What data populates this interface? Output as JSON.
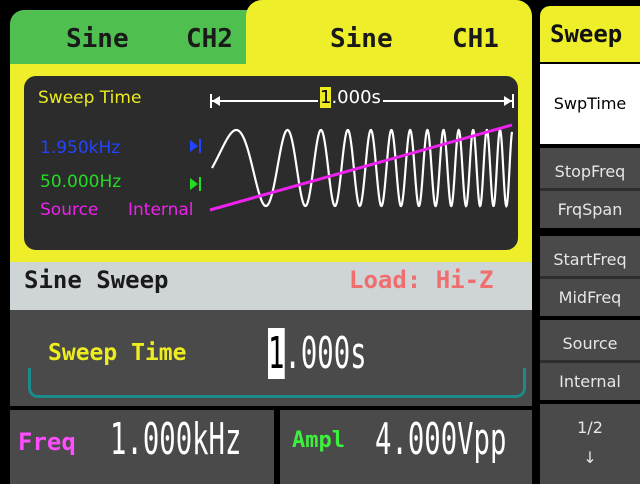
{
  "tabs": [
    {
      "wave": "Sine",
      "channel": "CH2"
    },
    {
      "wave": "Sine",
      "channel": "CH1"
    }
  ],
  "graph": {
    "sweep_time_label": "Sweep Time",
    "sweep_time_value": "1.000s",
    "stop_freq": "1.950kHz",
    "start_freq": "50.000Hz",
    "source_label": "Source",
    "source_value": "Internal"
  },
  "mode": {
    "title": "Sine Sweep",
    "load": "Load: Hi-Z"
  },
  "param": {
    "label": "Sweep Time",
    "value_cursor": "1",
    "value_rest": ".000s"
  },
  "freq": {
    "label": "Freq",
    "value": "1.000kHz"
  },
  "ampl": {
    "label": "Ampl",
    "value": "4.000Vpp"
  },
  "menu": {
    "title": "Sweep",
    "items": [
      {
        "top": "SwpTime",
        "bottom": ""
      },
      {
        "top": "StopFreq",
        "bottom": "FrqSpan"
      },
      {
        "top": "StartFreq",
        "bottom": "MidFreq"
      },
      {
        "top": "Source",
        "bottom": "Internal"
      },
      {
        "top": "1/2",
        "bottom": "↓"
      }
    ]
  },
  "colors": {
    "ch1_tab": "#eeee2a",
    "ch2_tab": "#4fbf4f",
    "stop_freq": "#2244ff",
    "start_freq": "#22dd22",
    "source": "#ee22ee",
    "load": "#ef6f6f"
  }
}
